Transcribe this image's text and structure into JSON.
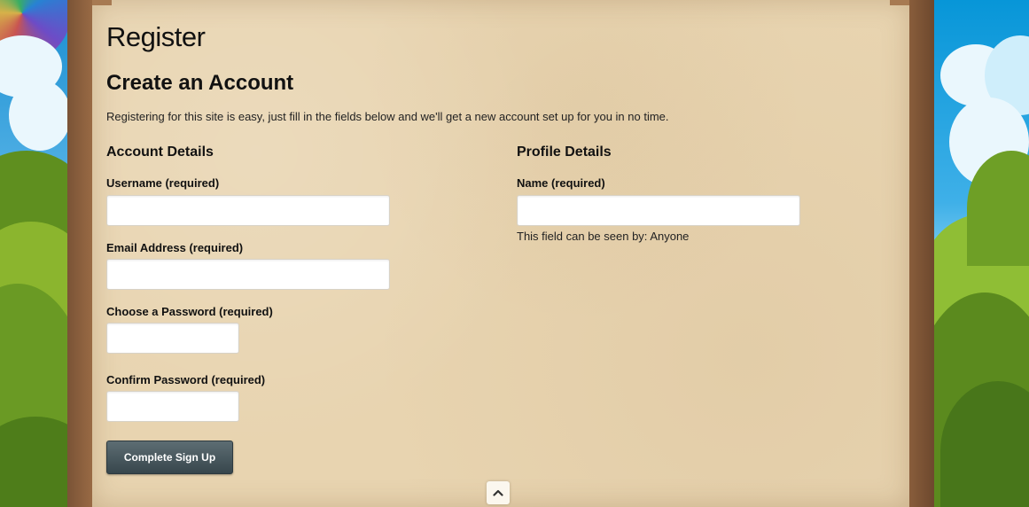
{
  "page": {
    "title": "Register",
    "heading": "Create an Account",
    "intro": "Registering for this site is easy, just fill in the fields below and we'll get a new account set up for you in no time."
  },
  "account": {
    "title": "Account Details",
    "username_label": "Username (required)",
    "username_value": "",
    "email_label": "Email Address (required)",
    "email_value": "",
    "password_label": "Choose a Password (required)",
    "password_value": "",
    "confirm_label": "Confirm Password (required)",
    "confirm_value": ""
  },
  "profile": {
    "title": "Profile Details",
    "name_label": "Name (required)",
    "name_value": "",
    "visibility_note": "This field can be seen by: Anyone"
  },
  "actions": {
    "submit_label": "Complete Sign Up",
    "back_to_top_icon": "chevron-up-icon"
  }
}
